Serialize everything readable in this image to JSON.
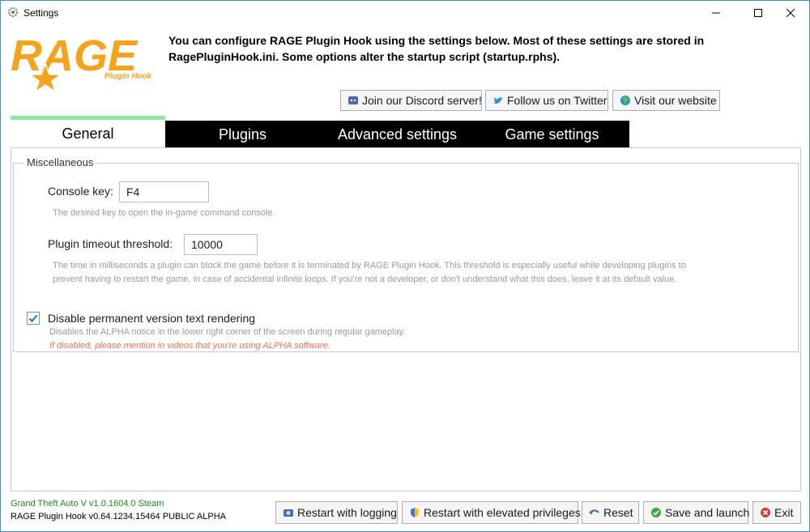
{
  "window": {
    "title": "Settings"
  },
  "logo": {
    "main": "RAGE",
    "sub": "Plugin Hook"
  },
  "intro": {
    "text": "You can configure RAGE Plugin Hook using the settings below. Most of these settings are stored in RagePluginHook.ini. Some options alter the startup script (startup.rphs)."
  },
  "links": {
    "discord": "Join our Discord server!",
    "twitter": "Follow us on Twitter",
    "website": "Visit our website"
  },
  "tabs": [
    {
      "label": "General",
      "active": true
    },
    {
      "label": "Plugins",
      "active": false
    },
    {
      "label": "Advanced settings",
      "active": false
    },
    {
      "label": "Game settings",
      "active": false
    }
  ],
  "misc": {
    "legend": "Miscellaneous",
    "console_key_label": "Console key:",
    "console_key_value": "F4",
    "console_key_hint": "The desired key to open the in-game command console.",
    "timeout_label": "Plugin timeout threshold:",
    "timeout_value": "10000",
    "timeout_hint1": "The time in milliseconds a plugin can block the game before it is terminated by RAGE Plugin Hook. This threshold is especially useful while developing plugins to",
    "timeout_hint2": "prevent having to restart the game, in case of accidental infinite loops. If you're not a developer, or don't understand what this does, leave it at its default value.",
    "disable_version_label": "Disable permanent version text rendering",
    "disable_version_checked": true,
    "disable_version_hint": "Disables the ALPHA notice in the lower right corner of the screen during regular gameplay.",
    "disable_version_warn": "If disabled, please mention in videos that you're using ALPHA software."
  },
  "status": {
    "game": "Grand Theft Auto V v1.0.1604.0 Steam",
    "rph": "RAGE Plugin Hook v0.64.1234.15464 PUBLIC ALPHA"
  },
  "buttons": {
    "restart_logging": "Restart with logging",
    "restart_elevated": "Restart with elevated privileges",
    "reset": "Reset",
    "save_launch": "Save and launch",
    "exit": "Exit"
  },
  "colors": {
    "accent_tab": "#90e89a",
    "status_green": "#1c8a1c",
    "warn": "#f07050",
    "logo_orange": "#f7a21b"
  }
}
